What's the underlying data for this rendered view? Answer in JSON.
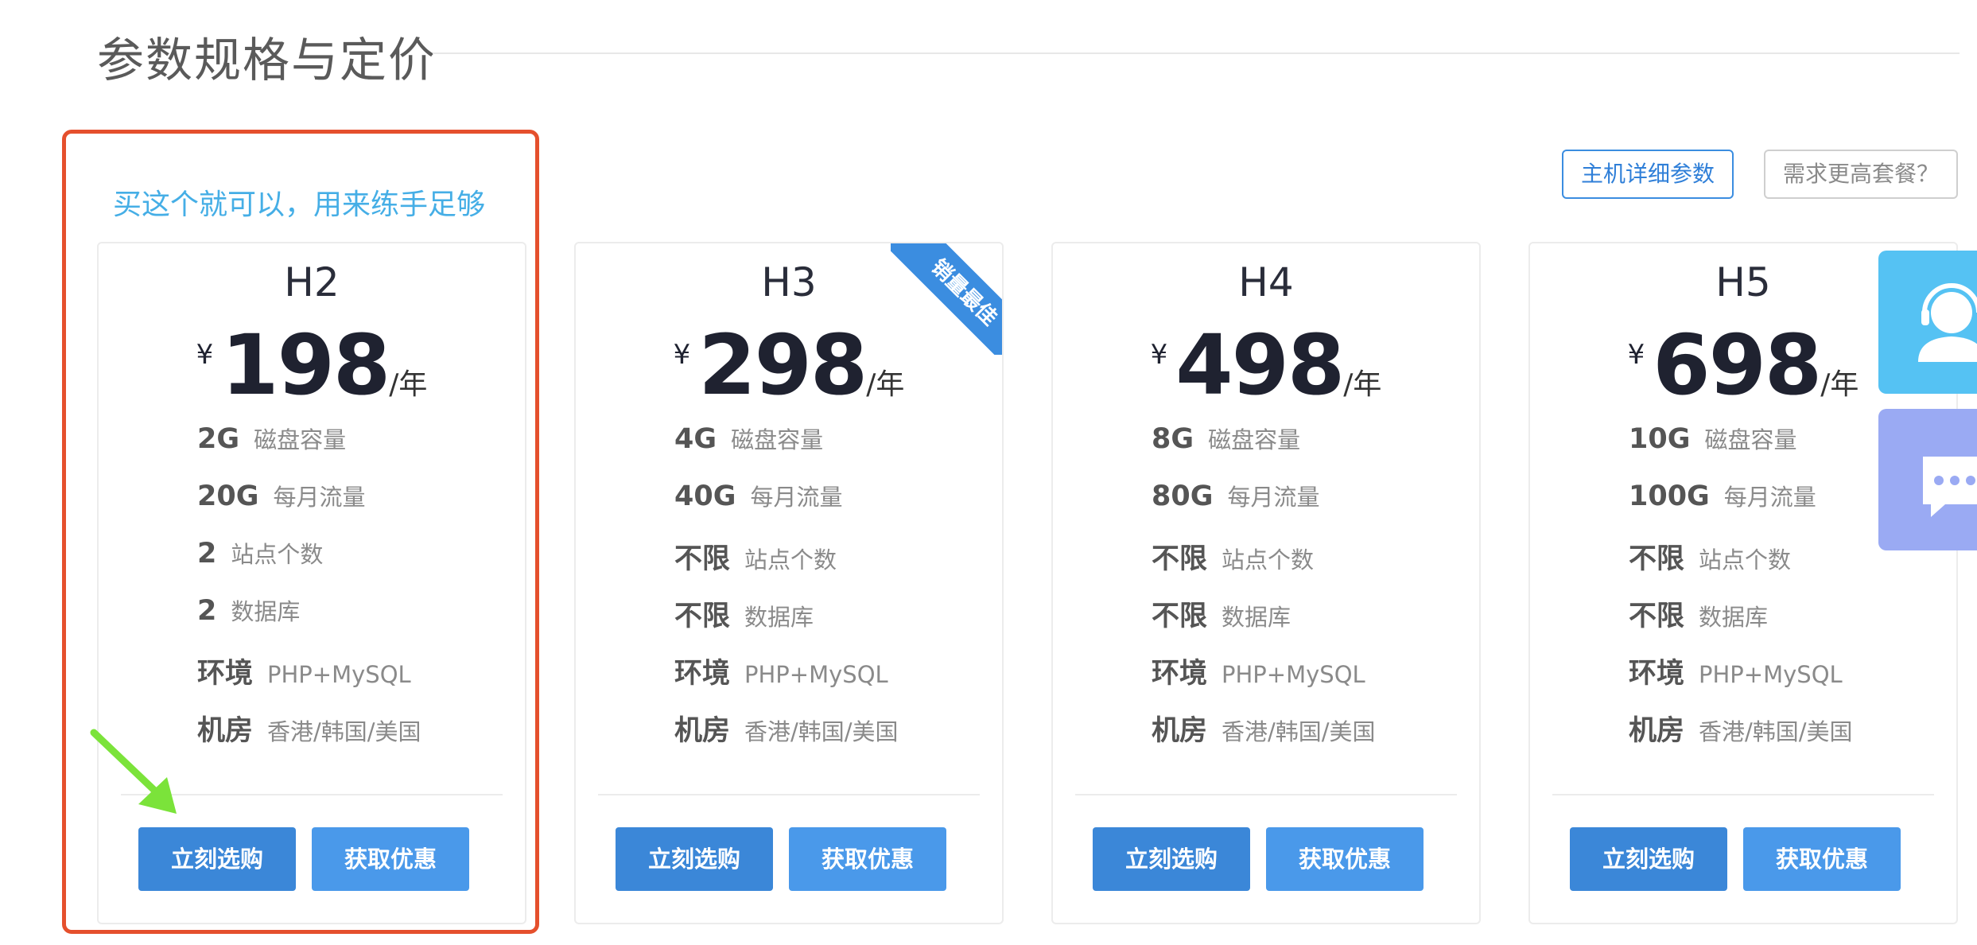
{
  "section_title": "参数规格与定价",
  "hint_text": "买这个就可以，用来练手足够",
  "top_buttons": {
    "details": "主机详细参数",
    "upgrade": "需求更高套餐？"
  },
  "colors": {
    "highlight_border": "#e5502d",
    "hint": "#45aee6",
    "primary": "#3b87d8",
    "secondary_button": "#4a99ea",
    "side_service": "#55c2f3",
    "side_chat": "#9aaaf3",
    "arrow": "#7be33a"
  },
  "plans": [
    {
      "name": "H2",
      "currency": "¥",
      "price": "198",
      "unit": "/年",
      "badge": "",
      "specs": [
        {
          "value": "2G",
          "label": "磁盘容量"
        },
        {
          "value": "20G",
          "label": "每月流量"
        },
        {
          "value": "2",
          "label": "站点个数"
        },
        {
          "value": "2",
          "label": "数据库"
        },
        {
          "value": "环境",
          "label": "PHP+MySQL"
        },
        {
          "value": "机房",
          "label": "香港/韩国/美国"
        }
      ],
      "buy_label": "立刻选购",
      "deal_label": "获取优惠"
    },
    {
      "name": "H3",
      "currency": "¥",
      "price": "298",
      "unit": "/年",
      "badge": "销量最佳",
      "specs": [
        {
          "value": "4G",
          "label": "磁盘容量"
        },
        {
          "value": "40G",
          "label": "每月流量"
        },
        {
          "value": "不限",
          "label": "站点个数"
        },
        {
          "value": "不限",
          "label": "数据库"
        },
        {
          "value": "环境",
          "label": "PHP+MySQL"
        },
        {
          "value": "机房",
          "label": "香港/韩国/美国"
        }
      ],
      "buy_label": "立刻选购",
      "deal_label": "获取优惠"
    },
    {
      "name": "H4",
      "currency": "¥",
      "price": "498",
      "unit": "/年",
      "badge": "",
      "specs": [
        {
          "value": "8G",
          "label": "磁盘容量"
        },
        {
          "value": "80G",
          "label": "每月流量"
        },
        {
          "value": "不限",
          "label": "站点个数"
        },
        {
          "value": "不限",
          "label": "数据库"
        },
        {
          "value": "环境",
          "label": "PHP+MySQL"
        },
        {
          "value": "机房",
          "label": "香港/韩国/美国"
        }
      ],
      "buy_label": "立刻选购",
      "deal_label": "获取优惠"
    },
    {
      "name": "H5",
      "currency": "¥",
      "price": "698",
      "unit": "/年",
      "badge": "",
      "specs": [
        {
          "value": "10G",
          "label": "磁盘容量"
        },
        {
          "value": "100G",
          "label": "每月流量"
        },
        {
          "value": "不限",
          "label": "站点个数"
        },
        {
          "value": "不限",
          "label": "数据库"
        },
        {
          "value": "环境",
          "label": "PHP+MySQL"
        },
        {
          "value": "机房",
          "label": "香港/韩国/美国"
        }
      ],
      "buy_label": "立刻选购",
      "deal_label": "获取优惠"
    }
  ],
  "side_buttons": [
    {
      "icon": "customer-service-icon"
    },
    {
      "icon": "chat-bubble-icon"
    }
  ]
}
